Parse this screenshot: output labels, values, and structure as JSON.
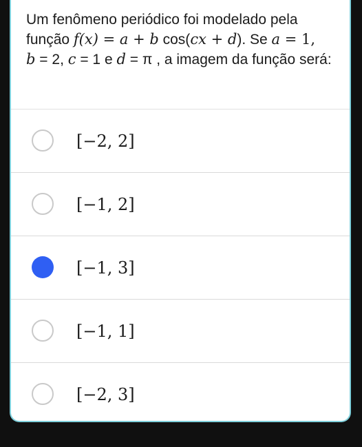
{
  "question": {
    "p1": "Um fenômeno periódico foi modelado pela função ",
    "fx": "f(x)",
    "eq1": " = ",
    "a": "a",
    "plus1": " + ",
    "b": "b",
    "cos": "  cos(",
    "cx": "cx",
    "plus2": " + ",
    "d": "d",
    "close": ")",
    "p2": ". Se ",
    "a2": "a",
    "eqa": " = 1,",
    "b2": "b",
    "eqb": " = 2, ",
    "c2": "c",
    "eqc": " = 1",
    "e": " e ",
    "d2": "d",
    "eqd": " = π",
    "p3": " , a imagem da função será:"
  },
  "options": [
    {
      "label": "[−2, 2]",
      "selected": false
    },
    {
      "label": "[−1, 2]",
      "selected": false
    },
    {
      "label": "[−1, 3]",
      "selected": true
    },
    {
      "label": "[−1, 1]",
      "selected": false
    },
    {
      "label": "[−2, 3]",
      "selected": false
    }
  ],
  "colors": {
    "selected_radio": "#2f5ff3",
    "card_border": "#7fd0dc"
  }
}
